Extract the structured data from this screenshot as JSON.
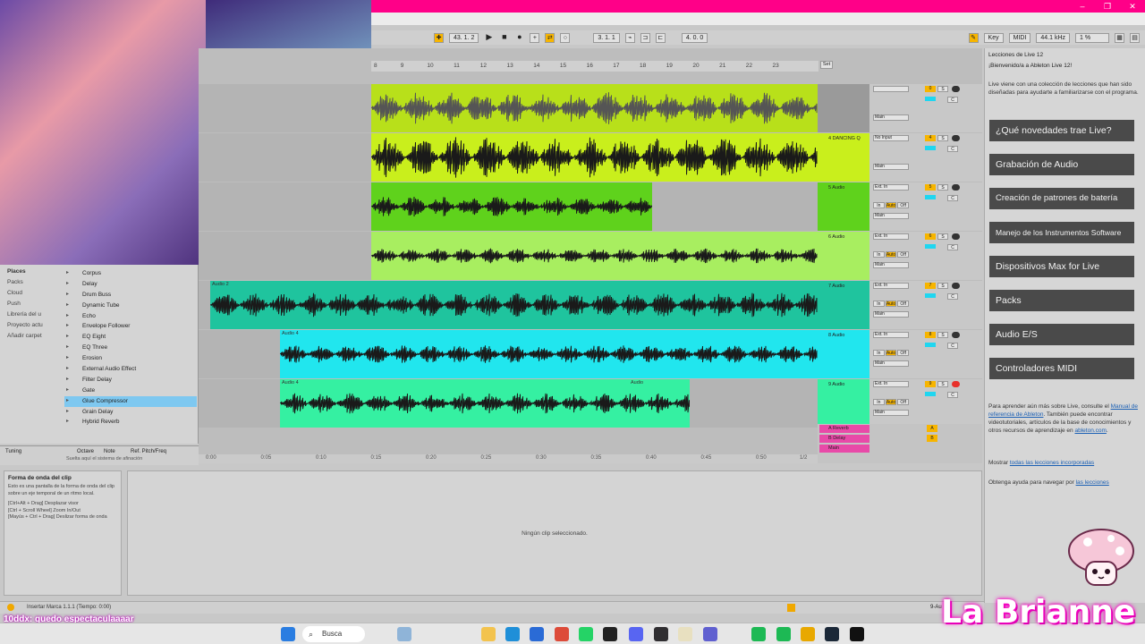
{
  "window": {
    "controls": [
      "–",
      "❐",
      "✕"
    ]
  },
  "transport": {
    "tempo": "43. 1. 2",
    "position": "3. 1. 1",
    "loop_length": "4. 0. 0",
    "key_label": "Key",
    "midi_label": "MIDI",
    "sample_rate": "44.1 kHz",
    "cpu": "1 %"
  },
  "browser": {
    "places_label": "Places",
    "places": [
      "Packs",
      "Cloud",
      "Push",
      "Librería del u",
      "Proyecto actu",
      "Añadir carpet"
    ],
    "devices": [
      "Corpus",
      "Delay",
      "Drum Buss",
      "Dynamic Tube",
      "Echo",
      "Envelope Follower",
      "EQ Eight",
      "EQ Three",
      "Erosion",
      "External Audio Effect",
      "Filter Delay",
      "Gate",
      "Glue Compressor",
      "Grain Delay",
      "Hybrid Reverb"
    ],
    "selected_device": "Glue Compressor"
  },
  "tuning": {
    "label": "Tuning",
    "octave": "Octave",
    "note": "Note",
    "ref": "Ref. Pitch/Freq",
    "drop_hint": "Suelta aquí el sistema de afinación"
  },
  "info": {
    "title": "Forma de onda del clip",
    "text1": "Esto es una pantalla de la forma de onda del clip sobre un eje temporal de un ritmo local.",
    "text2": "[Ctrl+Alt + Drag] Desplazar visor",
    "text3": "[Ctrl + Scroll Wheel] Zoom In/Out",
    "text4": "[Mayús + Ctrl + Drag] Deslizar forma de onda"
  },
  "detail": {
    "empty_message": "Ningún clip seleccionado."
  },
  "ruler": {
    "bars": [
      "8",
      "9",
      "10",
      "11",
      "12",
      "13",
      "14",
      "15",
      "16",
      "17",
      "18",
      "19",
      "20",
      "21",
      "22",
      "23"
    ],
    "set_label": "Set"
  },
  "timebar": {
    "times": [
      "0:00",
      "0:05",
      "0:10",
      "0:15",
      "0:20",
      "0:25",
      "0:30",
      "0:35",
      "0:40",
      "0:45",
      "0:50"
    ],
    "fraction": "1/2"
  },
  "tracks": [
    {
      "name": "",
      "clip_label": "",
      "color": "#b8e01a",
      "bg": "#9a9a9a",
      "input": "",
      "out": "Main",
      "vol": "0",
      "pan": "C"
    },
    {
      "name": "4 DANCING Q",
      "clip_label": "",
      "color": "#c9ef1c",
      "bg": "#c9ef1c",
      "input": "No Input",
      "out": "Main",
      "vol": "4",
      "pan": "C"
    },
    {
      "name": "5 Audio",
      "clip_label": "",
      "color": "#5fd21c",
      "bg": "#5fd21c",
      "input": "Ext. In",
      "out": "Main",
      "vol": "5",
      "pan": "C"
    },
    {
      "name": "6 Audio",
      "clip_label": "",
      "color": "#a8ee60",
      "bg": "#a8ee60",
      "input": "Ext. In",
      "out": "Main",
      "vol": "6",
      "pan": "C"
    },
    {
      "name": "7 Audio",
      "clip_label": "Audio 2",
      "color": "#1fc49e",
      "bg": "#1fc49e",
      "input": "Ext. In",
      "out": "Main",
      "vol": "7",
      "pan": "C"
    },
    {
      "name": "8 Audio",
      "clip_label": "Audio 4",
      "color": "#21e6ee",
      "bg": "#21e6ee",
      "input": "Ext. In",
      "out": "Main",
      "vol": "8",
      "pan": "C"
    },
    {
      "name": "9 Audio",
      "clip_label": "Audio 4",
      "clip_label2": "Audio",
      "color": "#35f0a2",
      "bg": "#35f0a2",
      "input": "Ext. In",
      "out": "Main",
      "vol": "9",
      "pan": "C"
    }
  ],
  "returns": [
    {
      "name": "A Reverb",
      "letter": "A",
      "color": "#e84aa8"
    },
    {
      "name": "B Delay",
      "letter": "B",
      "color": "#e84aa8"
    },
    {
      "name": "Main",
      "letter": "",
      "color": "#e84aa8"
    }
  ],
  "monitor": {
    "in": "In",
    "auto": "Auto",
    "off": "Off",
    "solo": "S"
  },
  "lessons": {
    "header": "Lecciones de Live 12",
    "welcome": "¡Bienvenido/a a Ableton Live 12!",
    "intro": "Live viene con una colección de lecciones que han sido diseñadas para ayudarte a familiarizarse con el programa.",
    "buttons": [
      "¿Qué novedades trae Live?",
      "Grabación de Audio",
      "Creación de patrones de batería",
      "Manejo de los Instrumentos Software",
      "Dispositivos Max for Live",
      "Packs",
      "Audio E/S",
      "Controladores MIDI"
    ],
    "more_prefix": "Para aprender aún más sobre Live, consulte el ",
    "more_link": "Manual de referencia de Ableton",
    "more_mid": ". También puede encontrar videotutoriales, artículos de la base de conocimientos y otros recursos de aprendizaje en ",
    "more_link2": "ableton.com",
    "show_prefix": "Mostrar ",
    "show_link": "todas las lecciones incorporadas",
    "help_prefix": "Obtenga ayuda para navegar por ",
    "help_link": "las lecciones"
  },
  "status": {
    "text": "Insertar Marca 1.1.1 (Tiempo: 0:00)",
    "track_hint": "9-Au"
  },
  "chat": {
    "user": "10ddx",
    "message": "quedo espectaculaaaar"
  },
  "taskbar": {
    "search_placeholder": "Busca"
  },
  "brand": {
    "name": "La Brianne"
  }
}
